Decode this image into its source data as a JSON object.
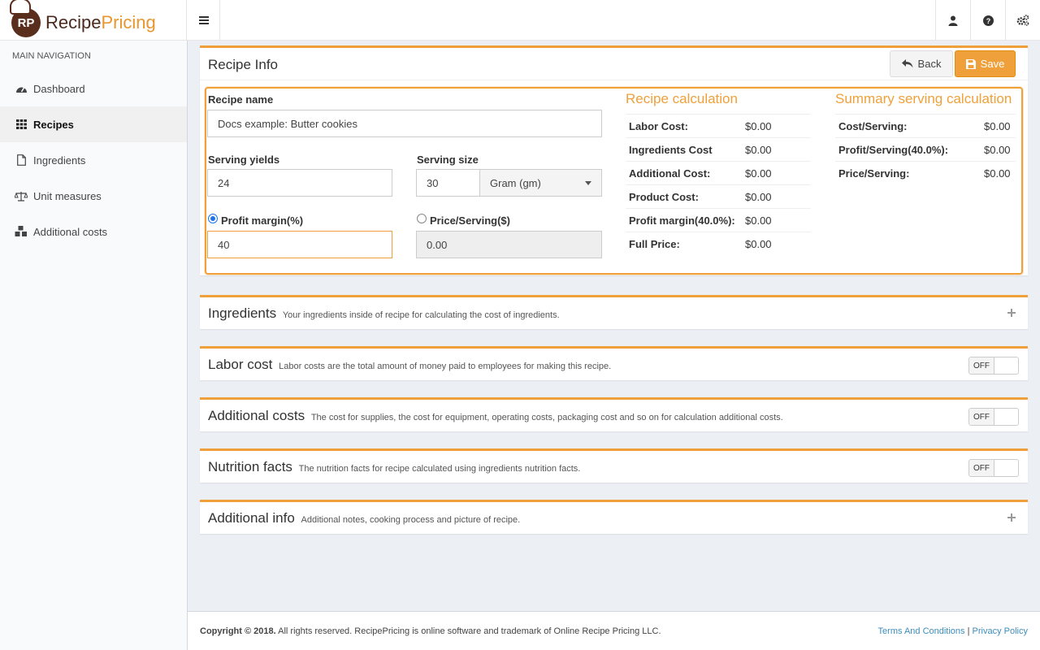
{
  "brand": {
    "initials": "RP",
    "name_part1": "Recipe",
    "name_part2": "Pricing"
  },
  "header": {
    "icons": [
      "user-icon",
      "question-icon",
      "cogs-icon"
    ]
  },
  "sidebar": {
    "heading": "MAIN NAVIGATION",
    "items": [
      {
        "label": "Dashboard",
        "icon": "dashboard-icon"
      },
      {
        "label": "Recipes",
        "icon": "grid-icon",
        "active": true
      },
      {
        "label": "Ingredients",
        "icon": "file-icon"
      },
      {
        "label": "Unit measures",
        "icon": "scale-icon"
      },
      {
        "label": "Additional costs",
        "icon": "cubes-icon"
      }
    ]
  },
  "recipe_info": {
    "title": "Recipe Info",
    "back_label": "Back",
    "save_label": "Save",
    "recipe_name_label": "Recipe name",
    "recipe_name_value": "Docs example: Butter cookies",
    "serving_yields_label": "Serving yields",
    "serving_yields_value": "24",
    "serving_size_label": "Serving size",
    "serving_size_value": "30",
    "serving_unit": "Gram (gm)",
    "profit_margin_label": "Profit margin(%)",
    "profit_margin_value": "40",
    "price_serving_label": "Price/Serving($)",
    "price_serving_value": "0.00"
  },
  "recipe_calculation": {
    "title": "Recipe calculation",
    "rows": [
      {
        "key": "Labor Cost:",
        "value": "$0.00"
      },
      {
        "key": "Ingredients Cost",
        "value": "$0.00"
      },
      {
        "key": "Additional Cost:",
        "value": "$0.00"
      },
      {
        "key": "Product Cost:",
        "value": "$0.00"
      },
      {
        "key": "Profit margin(40.0%):",
        "value": "$0.00"
      },
      {
        "key": "Full Price:",
        "value": "$0.00"
      }
    ]
  },
  "summary_calculation": {
    "title": "Summary serving calculation",
    "rows": [
      {
        "key": "Cost/Serving:",
        "value": "$0.00"
      },
      {
        "key": "Profit/Serving(40.0%):",
        "value": "$0.00"
      },
      {
        "key": "Price/Serving:",
        "value": "$0.00"
      }
    ]
  },
  "sections": [
    {
      "title": "Ingredients",
      "desc": "Your ingredients inside of recipe for calculating the cost of ingredients.",
      "control": "plus"
    },
    {
      "title": "Labor cost",
      "desc": "Labor costs are the total amount of money paid to employees for making this recipe.",
      "control": "toggle",
      "toggle_label": "OFF"
    },
    {
      "title": "Additional costs",
      "desc": "The cost for supplies, the cost for equipment, operating costs, packaging cost and so on for calculation additional costs.",
      "control": "toggle",
      "toggle_label": "OFF"
    },
    {
      "title": "Nutrition facts",
      "desc": "The nutrition facts for recipe calculated using ingredients nutrition facts.",
      "control": "toggle",
      "toggle_label": "OFF"
    },
    {
      "title": "Additional info",
      "desc": "Additional notes, cooking process and picture of recipe.",
      "control": "plus"
    }
  ],
  "footer": {
    "copyright_bold": "Copyright © 2018.",
    "copyright_rest": "All rights reserved. RecipePricing is online software and trademark of Online Recipe Pricing LLC.",
    "terms": "Terms And Conditions",
    "separator": "|",
    "privacy": "Privacy Policy"
  }
}
